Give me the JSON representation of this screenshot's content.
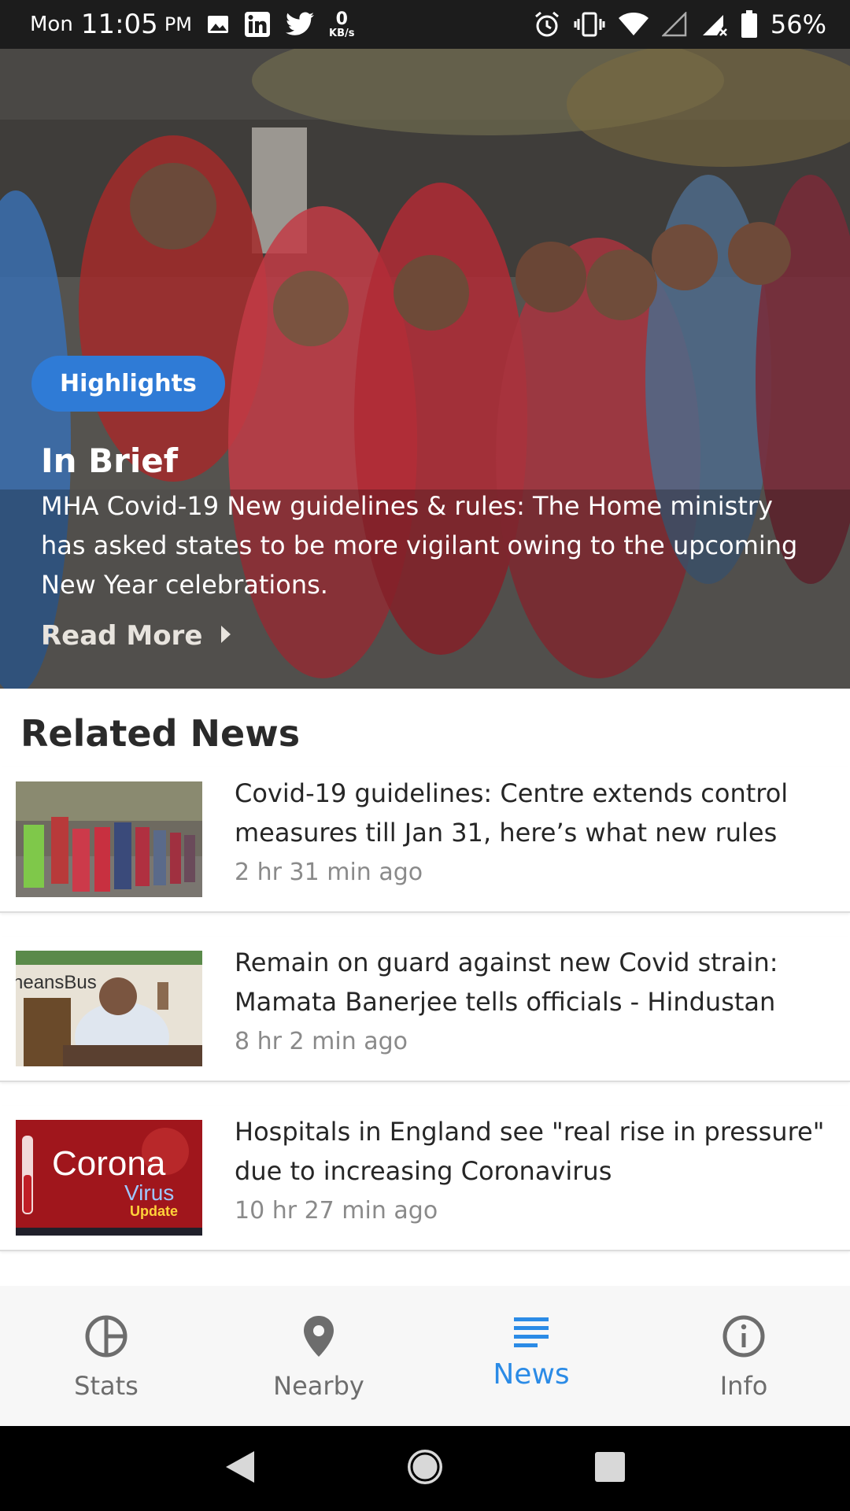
{
  "status_bar": {
    "day": "Mon",
    "time": "11:05",
    "ampm": "PM",
    "net_speed": "0",
    "net_unit": "KB/s",
    "battery": "56%"
  },
  "hero": {
    "badge": "Highlights",
    "title": "In Brief",
    "body": "MHA Covid-19 New guidelines & rules: The Home ministry has asked states to be more vigilant owing to the upcoming New Year celebrations.",
    "read_more": "Read More"
  },
  "related": {
    "title": "Related News",
    "items": [
      {
        "title": "Covid-19 guidelines: Centre extends control measures till Jan 31, here’s what new rules",
        "time": "2 hr 31 min ago"
      },
      {
        "title": "Remain on guard against new Covid strain: Mamata Banerjee tells officials - Hindustan",
        "time": "8 hr 2 min ago",
        "thumb_text": "neansBus"
      },
      {
        "title": "Hospitals in England see \"real rise in pressure\" due to increasing Coronavirus",
        "time": "10 hr 27 min ago",
        "thumb_line1": "Corona",
        "thumb_line2": "Virus",
        "thumb_line3": "Update"
      }
    ]
  },
  "bottom_nav": {
    "items": [
      {
        "label": "Stats",
        "icon": "pie-chart-icon"
      },
      {
        "label": "Nearby",
        "icon": "location-pin-icon"
      },
      {
        "label": "News",
        "icon": "list-icon"
      },
      {
        "label": "Info",
        "icon": "info-icon"
      }
    ],
    "active": "News"
  },
  "colors": {
    "accent": "#2b8be6",
    "badge": "#2f7bd6"
  }
}
